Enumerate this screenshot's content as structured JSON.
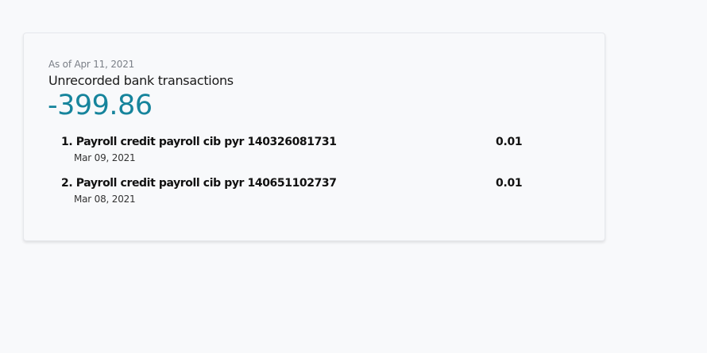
{
  "widget": {
    "as_of": "As of Apr 11, 2021",
    "title": "Unrecorded bank transactions",
    "total": "-399.86",
    "accent_color": "#16849c"
  },
  "transactions": [
    {
      "label": "1. Payroll credit payroll cib pyr 140326081731",
      "amount": "0.01",
      "date": "Mar 09, 2021"
    },
    {
      "label": "2. Payroll credit payroll cib pyr 140651102737",
      "amount": "0.01",
      "date": "Mar 08, 2021"
    }
  ]
}
